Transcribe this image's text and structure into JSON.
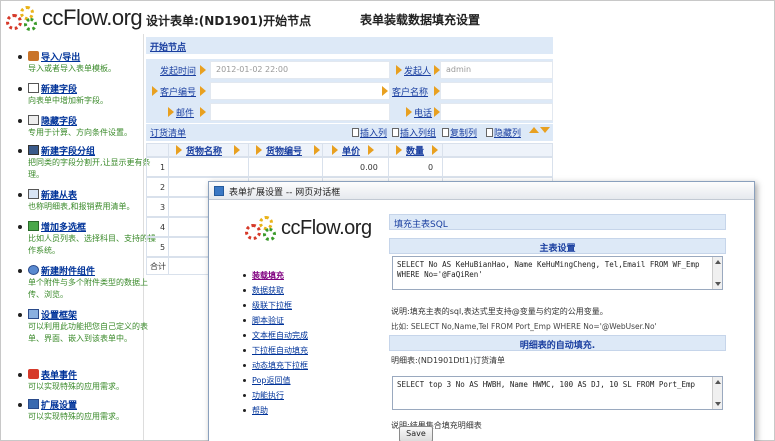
{
  "app": {
    "logo_text": "ccFlow.org",
    "designer_title": "设计表单:(ND1901)开始节点",
    "page_heading": "表单装载数据填充设置"
  },
  "sidebar": {
    "items": [
      {
        "title": "导入/导出",
        "desc": "导入或者导入表单模板。",
        "icon": "import-export-icon"
      },
      {
        "title": "新建字段",
        "desc": "向表单中增加新字段。",
        "icon": "new-field-icon"
      },
      {
        "title": "隐藏字段",
        "desc": "专用于计算、方向条件设置。",
        "icon": "hidden-field-icon"
      },
      {
        "title": "新建字段分组",
        "desc": "把同类的字段分割开,让显示更有条理。",
        "icon": "field-group-icon"
      },
      {
        "title": "新建从表",
        "desc": "也称明细表,和报销费用清单。",
        "icon": "detail-table-icon"
      },
      {
        "title": "增加多选框",
        "desc": "比如人员列表、选择科目、支持的操作系统。",
        "icon": "multi-select-icon"
      },
      {
        "title": "新建附件组件",
        "desc": "单个附件与多个附件类型的数据上传、浏览。",
        "icon": "attachment-icon"
      },
      {
        "title": "设置框架",
        "desc": "可以利用此功能把您自己定义的表单、界面、嵌入到该表单中。",
        "icon": "frame-icon"
      },
      {
        "title": "表单事件",
        "desc": "可以实现特殊的应用需求。",
        "icon": "form-event-icon"
      },
      {
        "title": "扩展设置",
        "desc": "可以实现特殊的应用需求。",
        "icon": "extension-icon"
      }
    ]
  },
  "form": {
    "node_title": "开始节点",
    "fields": [
      {
        "label": "发起时间",
        "value": "2012-01-02 22:00"
      },
      {
        "label": "发起人",
        "value": "admin"
      },
      {
        "label": "客户编号",
        "value": ""
      },
      {
        "label": "客户名称",
        "value": ""
      },
      {
        "label": "邮件",
        "value": ""
      },
      {
        "label": "电话",
        "value": ""
      }
    ],
    "detail": {
      "title": "订货清单",
      "buttons": [
        "插入列",
        "插入列组",
        "复制列",
        "隐藏列"
      ],
      "columns": [
        "货物名称",
        "货物编号",
        "单价",
        "数量"
      ],
      "rows": [
        {
          "num": "1",
          "price": "0.00",
          "qty": "0"
        },
        {
          "num": "2",
          "price": "",
          "qty": ""
        },
        {
          "num": "3",
          "price": "",
          "qty": ""
        },
        {
          "num": "4",
          "price": "",
          "qty": ""
        },
        {
          "num": "5",
          "price": "",
          "qty": ""
        }
      ],
      "total_label": "合计"
    }
  },
  "dialog": {
    "title": "表单扩展设置 -- 网页对话框",
    "logo_text": "ccFlow.org",
    "nav": [
      "装载填充",
      "数据获取",
      "级联下拉框",
      "脚本验证",
      "文本框自动完成",
      "下拉框自动填充",
      "动态填充下拉框",
      "Pop返回值",
      "功能执行",
      "帮助"
    ],
    "active_nav": "装载填充",
    "content": {
      "panel_title": "填充主表SQL",
      "main_head": "主表设置",
      "main_sql": "SELECT No AS KeHuBianHao, Name KeHuMingCheng, Tel,Email FROM WF_Emp WHERE No='@FaQiRen'",
      "note1": "说明:填充主表的sql,表达式里支持@变量与约定的公用变量。",
      "note2": "比如: SELECT No,Name,Tel FROM Port_Emp WHERE No='@WebUser.No'",
      "detail_head": "明细表的自动填充.",
      "detail_label": "明细表:(ND1901Dtl1)订货清单",
      "detail_sql": "SELECT top 3 No AS HWBH, Name HWMC, 100 AS DJ, 10 SL FROM Port_Emp",
      "note3": "说明:结果集合填充明细表",
      "save_label": "Save"
    }
  },
  "colors": {
    "link": "#1a3fa0",
    "header_bar": "#dde9f7",
    "desc_green": "#3a8a2a",
    "arrow_orange": "#e8a020"
  }
}
